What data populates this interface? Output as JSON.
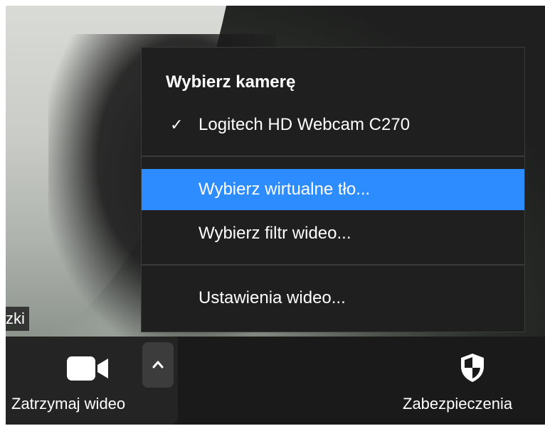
{
  "video": {
    "participant_name_fragment": "zki"
  },
  "camera_menu": {
    "header": "Wybierz kamerę",
    "camera_option": "Logitech HD Webcam C270",
    "camera_selected_mark": "✓",
    "virtual_background": "Wybierz wirtualne tło...",
    "video_filter": "Wybierz filtr wideo...",
    "video_settings": "Ustawienia wideo...",
    "highlight_color": "#2d8cff"
  },
  "toolbar": {
    "stop_video_label": "Zatrzymaj wideo",
    "security_label": "Zabezpieczenia",
    "icons": [
      "video-camera-icon",
      "chevron-up-icon",
      "shield-icon"
    ]
  }
}
